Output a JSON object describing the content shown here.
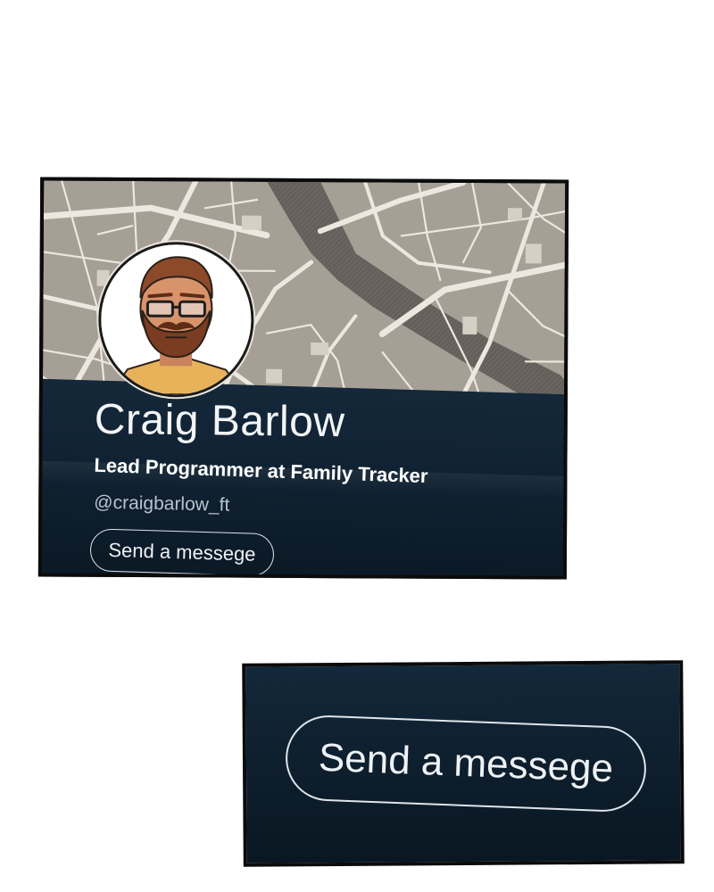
{
  "profile_card": {
    "name": "Craig Barlow",
    "title": "Lead Programmer at Family Tracker",
    "handle": "@craigbarlow_ft",
    "send_button_label": "Send a messege",
    "avatar_icon": "bearded-man-with-glasses-avatar",
    "background": "street-map"
  },
  "zoom_panel": {
    "send_button_label": "Send a messege"
  },
  "colors": {
    "card_background": "#0f1d29",
    "map_blocks": "#a59f95",
    "map_streets": "#ece8df",
    "river": "#6a6560",
    "text_primary": "#f2f4f6",
    "text_secondary": "#b9c3cc"
  }
}
